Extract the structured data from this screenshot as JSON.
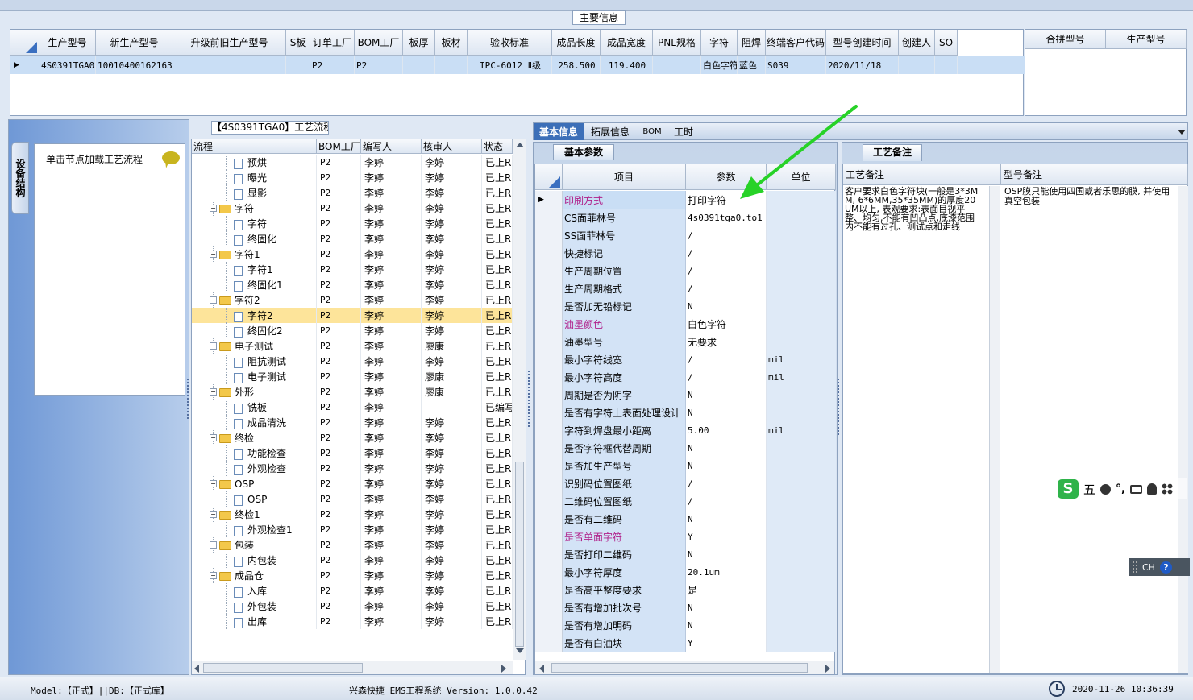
{
  "main_info": {
    "title": "主要信息",
    "columns": [
      "生产型号",
      "新生产型号",
      "升级前旧生产型号",
      "S板",
      "订单工厂",
      "BOM工厂",
      "板厚",
      "板材",
      "验收标准",
      "成品长度",
      "成品宽度",
      "PNL规格",
      "字符",
      "阻焊",
      "终端客户代码",
      "型号创建时间",
      "创建人",
      "SO"
    ],
    "row": [
      "4S0391TGA0",
      "10010400162163",
      "",
      "",
      "P2",
      "P2",
      "",
      "",
      "IPC-6012 Ⅱ级",
      "258.500",
      "119.400",
      "",
      "白色字符",
      "蓝色",
      "S039",
      "2020/11/18",
      "",
      ""
    ],
    "right_columns": [
      "合拼型号",
      "生产型号"
    ]
  },
  "left_panel": {
    "vertical_tab": "设备结构",
    "node_hint": "单击节点加载工艺流程"
  },
  "process": {
    "title": "【4S0391TGA0】工艺流程",
    "columns": [
      "流程",
      "BOM工厂",
      "编写人",
      "核审人",
      "状态"
    ],
    "rows": [
      {
        "name": "预烘",
        "type": "doc",
        "bom": "P2",
        "writer": "李婷",
        "reviewer": "李婷",
        "status": "已上R"
      },
      {
        "name": "曝光",
        "type": "doc",
        "bom": "P2",
        "writer": "李婷",
        "reviewer": "李婷",
        "status": "已上R"
      },
      {
        "name": "显影",
        "type": "doc",
        "bom": "P2",
        "writer": "李婷",
        "reviewer": "李婷",
        "status": "已上R"
      },
      {
        "name": "字符",
        "type": "folder",
        "bom": "P2",
        "writer": "李婷",
        "reviewer": "李婷",
        "status": "已上R"
      },
      {
        "name": "字符",
        "type": "doc",
        "bom": "P2",
        "writer": "李婷",
        "reviewer": "李婷",
        "status": "已上R"
      },
      {
        "name": "终固化",
        "type": "doc",
        "bom": "P2",
        "writer": "李婷",
        "reviewer": "李婷",
        "status": "已上R"
      },
      {
        "name": "字符1",
        "type": "folder",
        "bom": "P2",
        "writer": "李婷",
        "reviewer": "李婷",
        "status": "已上R"
      },
      {
        "name": "字符1",
        "type": "doc",
        "bom": "P2",
        "writer": "李婷",
        "reviewer": "李婷",
        "status": "已上R"
      },
      {
        "name": "终固化1",
        "type": "doc",
        "bom": "P2",
        "writer": "李婷",
        "reviewer": "李婷",
        "status": "已上R"
      },
      {
        "name": "字符2",
        "type": "folder",
        "bom": "P2",
        "writer": "李婷",
        "reviewer": "李婷",
        "status": "已上R"
      },
      {
        "name": "字符2",
        "type": "doc",
        "bom": "P2",
        "writer": "李婷",
        "reviewer": "李婷",
        "status": "已上R",
        "selected": true
      },
      {
        "name": "终固化2",
        "type": "doc",
        "bom": "P2",
        "writer": "李婷",
        "reviewer": "李婷",
        "status": "已上R"
      },
      {
        "name": "电子测试",
        "type": "folder",
        "bom": "P2",
        "writer": "李婷",
        "reviewer": "廖康",
        "status": "已上R"
      },
      {
        "name": "阻抗测试",
        "type": "doc",
        "bom": "P2",
        "writer": "李婷",
        "reviewer": "李婷",
        "status": "已上R"
      },
      {
        "name": "电子测试",
        "type": "doc",
        "bom": "P2",
        "writer": "李婷",
        "reviewer": "廖康",
        "status": "已上R"
      },
      {
        "name": "外形",
        "type": "folder",
        "bom": "P2",
        "writer": "李婷",
        "reviewer": "廖康",
        "status": "已上R"
      },
      {
        "name": "铣板",
        "type": "doc",
        "bom": "P2",
        "writer": "李婷",
        "reviewer": "",
        "status": "已编写"
      },
      {
        "name": "成品清洗",
        "type": "doc",
        "bom": "P2",
        "writer": "李婷",
        "reviewer": "李婷",
        "status": "已上R"
      },
      {
        "name": "终检",
        "type": "folder",
        "bom": "P2",
        "writer": "李婷",
        "reviewer": "李婷",
        "status": "已上R"
      },
      {
        "name": "功能检查",
        "type": "doc",
        "bom": "P2",
        "writer": "李婷",
        "reviewer": "李婷",
        "status": "已上R"
      },
      {
        "name": "外观检查",
        "type": "doc",
        "bom": "P2",
        "writer": "李婷",
        "reviewer": "李婷",
        "status": "已上R"
      },
      {
        "name": "OSP",
        "type": "folder",
        "bom": "P2",
        "writer": "李婷",
        "reviewer": "李婷",
        "status": "已上R"
      },
      {
        "name": "OSP",
        "type": "doc",
        "bom": "P2",
        "writer": "李婷",
        "reviewer": "李婷",
        "status": "已上R"
      },
      {
        "name": "终检1",
        "type": "folder",
        "bom": "P2",
        "writer": "李婷",
        "reviewer": "李婷",
        "status": "已上R"
      },
      {
        "name": "外观检查1",
        "type": "doc",
        "bom": "P2",
        "writer": "李婷",
        "reviewer": "李婷",
        "status": "已上R"
      },
      {
        "name": "包装",
        "type": "folder",
        "bom": "P2",
        "writer": "李婷",
        "reviewer": "李婷",
        "status": "已上R"
      },
      {
        "name": "内包装",
        "type": "doc",
        "bom": "P2",
        "writer": "李婷",
        "reviewer": "李婷",
        "status": "已上R"
      },
      {
        "name": "成品仓",
        "type": "folder",
        "bom": "P2",
        "writer": "李婷",
        "reviewer": "李婷",
        "status": "已上R"
      },
      {
        "name": "入库",
        "type": "doc",
        "bom": "P2",
        "writer": "李婷",
        "reviewer": "李婷",
        "status": "已上R"
      },
      {
        "name": "外包装",
        "type": "doc",
        "bom": "P2",
        "writer": "李婷",
        "reviewer": "李婷",
        "status": "已上R"
      },
      {
        "name": "出库",
        "type": "doc",
        "bom": "P2",
        "writer": "李婷",
        "reviewer": "李婷",
        "status": "已上R"
      }
    ]
  },
  "tabs": [
    "基本信息",
    "拓展信息",
    "BOM",
    "工时"
  ],
  "basic_params": {
    "subtab": "基本参数",
    "columns": [
      "项目",
      "参数",
      "单位"
    ],
    "rows": [
      {
        "item": "印刷方式",
        "value": "打印字符",
        "unit": "",
        "highlight": true
      },
      {
        "item": "CS面菲林号",
        "value": "4s0391tga0.to1",
        "unit": ""
      },
      {
        "item": "SS面菲林号",
        "value": "/",
        "unit": ""
      },
      {
        "item": "快捷标记",
        "value": "/",
        "unit": ""
      },
      {
        "item": "生产周期位置",
        "value": "/",
        "unit": ""
      },
      {
        "item": "生产周期格式",
        "value": "/",
        "unit": ""
      },
      {
        "item": "是否加无铅标记",
        "value": "N",
        "unit": ""
      },
      {
        "item": "油墨颜色",
        "value": "白色字符",
        "unit": "",
        "highlight": true
      },
      {
        "item": "油墨型号",
        "value": "无要求",
        "unit": ""
      },
      {
        "item": "最小字符线宽",
        "value": "/",
        "unit": "mil"
      },
      {
        "item": "最小字符高度",
        "value": "/",
        "unit": "mil"
      },
      {
        "item": "周期是否为阴字",
        "value": "N",
        "unit": ""
      },
      {
        "item": "是否有字符上表面处理设计",
        "value": "N",
        "unit": ""
      },
      {
        "item": "字符到焊盘最小距离",
        "value": "5.00",
        "unit": "mil"
      },
      {
        "item": "是否字符框代替周期",
        "value": "N",
        "unit": ""
      },
      {
        "item": "是否加生产型号",
        "value": "N",
        "unit": ""
      },
      {
        "item": "识别码位置图纸",
        "value": "/",
        "unit": ""
      },
      {
        "item": "二维码位置图纸",
        "value": "/",
        "unit": ""
      },
      {
        "item": "是否有二维码",
        "value": "N",
        "unit": ""
      },
      {
        "item": "是否单面字符",
        "value": "Y",
        "unit": "",
        "highlight": true
      },
      {
        "item": "是否打印二维码",
        "value": "N",
        "unit": ""
      },
      {
        "item": "最小字符厚度",
        "value": "20.1um",
        "unit": ""
      },
      {
        "item": "是否高平整度要求",
        "value": "是",
        "unit": ""
      },
      {
        "item": "是否有增加批次号",
        "value": "N",
        "unit": ""
      },
      {
        "item": "是否有增加明码",
        "value": "N",
        "unit": ""
      },
      {
        "item": "是否有白油块",
        "value": "Y",
        "unit": ""
      }
    ]
  },
  "craft_notes": {
    "tab": "工艺备注",
    "col1": "工艺备注",
    "col2": "型号备注",
    "note1": "客户要求白色字符块(一般是3*3MM, 6*6MM,35*35MM)的厚度20UM以上, 表观要求:表面目视平整、均匀,不能有凹凸点,底漆范围内不能有过孔、测试点和走线",
    "note2": "OSP膜只能使用四国或者乐思的膜, 并使用真空包装"
  },
  "ime": {
    "mode": "五",
    "lang": "CH"
  },
  "status_bar": {
    "model": "Model:【正式】||DB:【正式库】",
    "app": "兴森快捷 EMS工程系统 Version: 1.0.0.42",
    "datetime": "2020-11-26 10:36:39"
  },
  "colors": {
    "highlight_text": "#b0208a",
    "selected_row": "#fde49a",
    "arrow": "#27d227"
  }
}
